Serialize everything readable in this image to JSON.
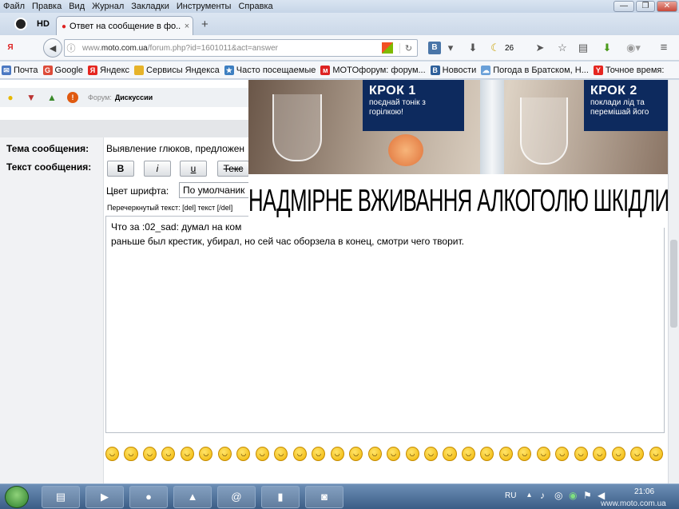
{
  "menu": [
    "Файл",
    "Правка",
    "Вид",
    "Журнал",
    "Закладки",
    "Инструменты",
    "Справка"
  ],
  "window_buttons": [
    "—",
    "❐",
    "✕"
  ],
  "tabbar": {
    "hd_label": "HD",
    "tab_title": "Ответ на сообщение в фо...",
    "tab_close": "×",
    "new_tab": "+"
  },
  "nav": {
    "url_prefix": "www.",
    "url_host": "moto.com.ua",
    "url_path": "/forum.php?id=1601011&act=answer",
    "reload": "↻",
    "vk_label": "В",
    "weather_value": "26"
  },
  "bookmarks": [
    {
      "label": "Почта",
      "icon": "mail-icon",
      "color": "#4a78c2",
      "glyph": "✉"
    },
    {
      "label": "Google",
      "icon": "google-icon",
      "color": "#dd4b39",
      "glyph": "G"
    },
    {
      "label": "Яндекс",
      "icon": "yandex-icon",
      "color": "#e52620",
      "glyph": "Я"
    },
    {
      "label": "Сервисы Яндекса",
      "icon": "folder-icon",
      "color": "#e6b32a",
      "glyph": ""
    },
    {
      "label": "Часто посещаемые",
      "icon": "frequent-icon",
      "color": "#3d7fc1",
      "glyph": "★"
    },
    {
      "label": "MOTOфорум: форум...",
      "icon": "moto-icon",
      "color": "#d22",
      "glyph": "м"
    },
    {
      "label": "Новости",
      "icon": "news-icon",
      "color": "#2d5f9a",
      "glyph": "В"
    },
    {
      "label": "Погода в Братском, Н...",
      "icon": "weather-icon",
      "color": "#6aa0d8",
      "glyph": "☁"
    },
    {
      "label": "Точное время:",
      "icon": "clock-icon",
      "color": "#e52620",
      "glyph": "Y"
    }
  ],
  "forum_row": {
    "prefix": "Форум:",
    "name": "Дискуссии"
  },
  "form": {
    "subject_label": "Тема сообщения:",
    "subject_value": "Выявление глюков, предложен",
    "text_label": "Текст сообщения:",
    "bold_btn": "B",
    "italic_btn": "i",
    "underline_btn": "u",
    "strike_btn": "Текс",
    "color_label": "Цвет шрифта:",
    "color_value": "По умолчаник",
    "strike_hint": "Перечеркнутый текст: [del] текст [/del]",
    "message_line1": "Что за  :02_sad: думал на ком",
    "message_line2": "раньше был крестик, убирал, но сей час оборзела в конец, смотри чего творит."
  },
  "ad": {
    "krok1_title": "КРОК 1",
    "krok1_text": "поєднай тонік з горілкою!",
    "krok2_title": "КРОК 2",
    "krok2_text": "поклади лід та перемішай його",
    "warning": "НАДМІРНЕ ВЖИВАННЯ АЛКОГОЛЮ ШКІДЛИВ"
  },
  "smilies_count": 30,
  "taskbar": {
    "apps": [
      {
        "name": "explorer-icon",
        "glyph": "▤"
      },
      {
        "name": "media-player-icon",
        "glyph": "▶"
      },
      {
        "name": "firefox-icon",
        "glyph": "●"
      },
      {
        "name": "app-triangle-icon",
        "glyph": "▲"
      },
      {
        "name": "mail-agent-icon",
        "glyph": "@"
      },
      {
        "name": "app-green-icon",
        "glyph": "▮"
      },
      {
        "name": "camera-icon",
        "glyph": "◙"
      }
    ],
    "lang": "RU",
    "time": "21:06",
    "watermark": "www.moto.com.ua"
  }
}
